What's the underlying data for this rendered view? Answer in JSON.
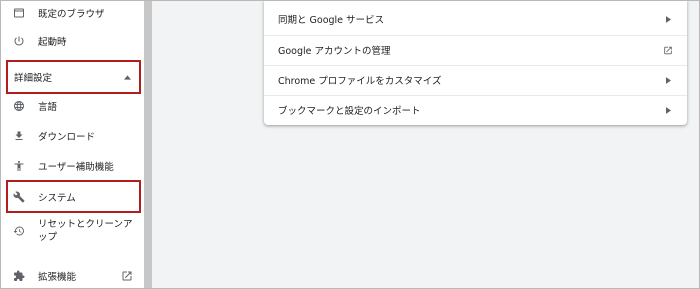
{
  "sidebar": {
    "items": [
      {
        "label": "既定のブラウザ",
        "icon": "browser-window-icon"
      },
      {
        "label": "起動時",
        "icon": "power-icon"
      },
      {
        "label": "言語",
        "icon": "globe-icon"
      },
      {
        "label": "ダウンロード",
        "icon": "download-icon"
      },
      {
        "label": "ユーザー補助機能",
        "icon": "accessibility-icon"
      },
      {
        "label": "システム",
        "icon": "wrench-icon"
      },
      {
        "label": "リセットとクリーンアップ",
        "icon": "restore-icon"
      },
      {
        "label": "拡張機能",
        "icon": "puzzle-icon",
        "trailing_icon": "external-link-icon"
      }
    ],
    "advanced_section": {
      "label": "詳細設定",
      "icon": "caret-up-icon",
      "expanded": true
    }
  },
  "card": {
    "rows": [
      {
        "label": "同期と Google サービス",
        "icon": "chevron-right-icon"
      },
      {
        "label": "Google アカウントの管理",
        "icon": "external-link-icon"
      },
      {
        "label": "Chrome プロファイルをカスタマイズ",
        "icon": "chevron-right-icon"
      },
      {
        "label": "ブックマークと設定のインポート",
        "icon": "chevron-right-icon"
      }
    ]
  },
  "colors": {
    "highlight": "#b01e1e",
    "main_background": "#f1f3f4",
    "icon": "#5f6368",
    "text": "#202124"
  }
}
